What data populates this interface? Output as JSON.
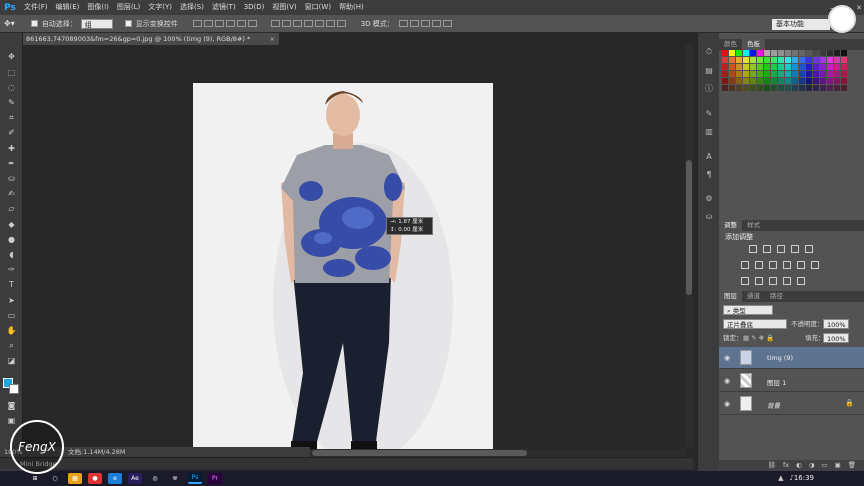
{
  "app": {
    "logo": "Ps",
    "window_controls": [
      "–",
      "▢",
      "✕"
    ]
  },
  "menu": [
    "文件(F)",
    "编辑(E)",
    "图像(I)",
    "图层(L)",
    "文字(Y)",
    "选择(S)",
    "滤镜(T)",
    "3D(D)",
    "视图(V)",
    "窗口(W)",
    "帮助(H)"
  ],
  "options": {
    "auto_select_label": "自动选择：",
    "auto_select_value": "组",
    "show_transform_label": "显示变换控件",
    "mode_3d_label": "3D 模式：",
    "workspace": "基本功能"
  },
  "document": {
    "tab_title": "861663,747089003&fm=26&gp=0.jpg @ 100% (timg (9), RGB/8#) *",
    "tab_close": "×"
  },
  "measure": {
    "line1": "→: 1.87 厘米",
    "line2": "↕: 0.00 厘米"
  },
  "status": {
    "zoom": "100%",
    "doc_info": "文档:1.14M/4.28M",
    "bridge": "Mini Bridge"
  },
  "panels": {
    "color_tabs": [
      "颜色",
      "色板"
    ],
    "adjust_tabs": [
      "调整",
      "样式"
    ],
    "adjust_title": "添加调整",
    "layer_tabs": [
      "图层",
      "通道",
      "路径"
    ],
    "filter_kind": "类型",
    "blend_mode": "正片叠底",
    "opacity_label": "不透明度：",
    "opacity_value": "100%",
    "lock_label": "锁定：",
    "fill_label": "填充：",
    "fill_value": "100%",
    "layers": [
      {
        "name": "timg (9)",
        "selected": true
      },
      {
        "name": "图层 1",
        "selected": false
      },
      {
        "name": "背景",
        "selected": false,
        "locked": true
      }
    ],
    "footer_icons": [
      "⛓",
      "fx",
      "◐",
      "◑",
      "▭",
      "▣",
      "🗑"
    ]
  },
  "taskbar": {
    "time": "16:39",
    "apps": [
      "⊞",
      "○",
      "▦",
      "●",
      "e",
      "Ae",
      "◎",
      "⛯",
      "Ps",
      "Pr"
    ]
  },
  "watermark": "FengX",
  "colors": {
    "accent_blue": "#31a8ff",
    "foreground_swatch": "#1ca7e6",
    "selected_layer": "#5d7390"
  }
}
